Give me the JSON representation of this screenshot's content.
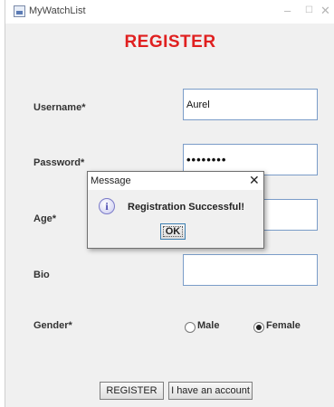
{
  "window": {
    "title": "MyWatchList",
    "min_glyph": "–",
    "max_glyph": "☐",
    "close_glyph": "✕",
    "icon": "java-app-icon"
  },
  "form": {
    "heading": "REGISTER",
    "username_label": "Username*",
    "username_value": "Aurel",
    "password_label": "Password*",
    "password_value": "••••••••",
    "age_label": "Age*",
    "age_value": "",
    "bio_label": "Bio",
    "bio_value": "",
    "gender_label": "Gender*",
    "gender_options": [
      {
        "label": "Male",
        "checked": false
      },
      {
        "label": "Female",
        "checked": true
      }
    ],
    "register_button": "REGISTER",
    "account_button": "I have an account"
  },
  "dialog": {
    "title": "Message",
    "close_glyph": "✕",
    "icon": "info-icon",
    "icon_glyph": "i",
    "message": "Registration Successful!",
    "ok_label": "OK"
  },
  "colors": {
    "heading": "#e02020",
    "field_border": "#7a9cc8",
    "window_bg": "#f0f0f0"
  }
}
